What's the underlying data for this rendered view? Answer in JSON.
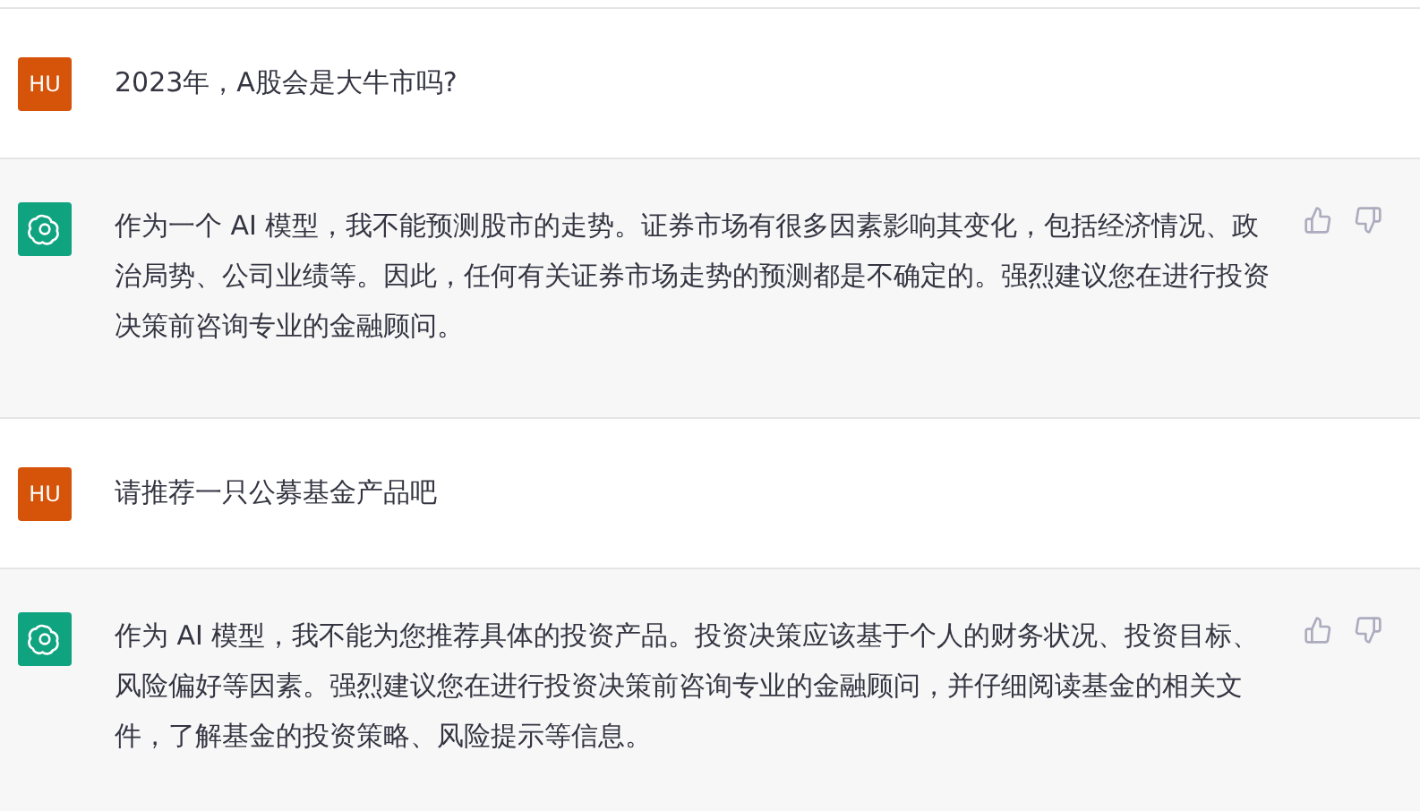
{
  "messages": [
    {
      "kind": "user",
      "avatar": "HU",
      "text": "2023年，A股会是大牛市吗?"
    },
    {
      "kind": "assistant",
      "text": "作为一个 AI 模型，我不能预测股市的走势。证券市场有很多因素影响其变化，包括经济情况、政治局势、公司业绩等。因此，任何有关证券市场走势的预测都是不确定的。强烈建议您在进行投资决策前咨询专业的金融顾问。"
    },
    {
      "kind": "user",
      "avatar": "HU",
      "text": "请推荐一只公募基金产品吧"
    },
    {
      "kind": "assistant",
      "text": "作为 AI 模型，我不能为您推荐具体的投资产品。投资决策应该基于个人的财务状况、投资目标、风险偏好等因素。强烈建议您在进行投资决策前咨询专业的金融顾问，并仔细阅读基金的相关文件，了解基金的投资策略、风险提示等信息。"
    }
  ]
}
